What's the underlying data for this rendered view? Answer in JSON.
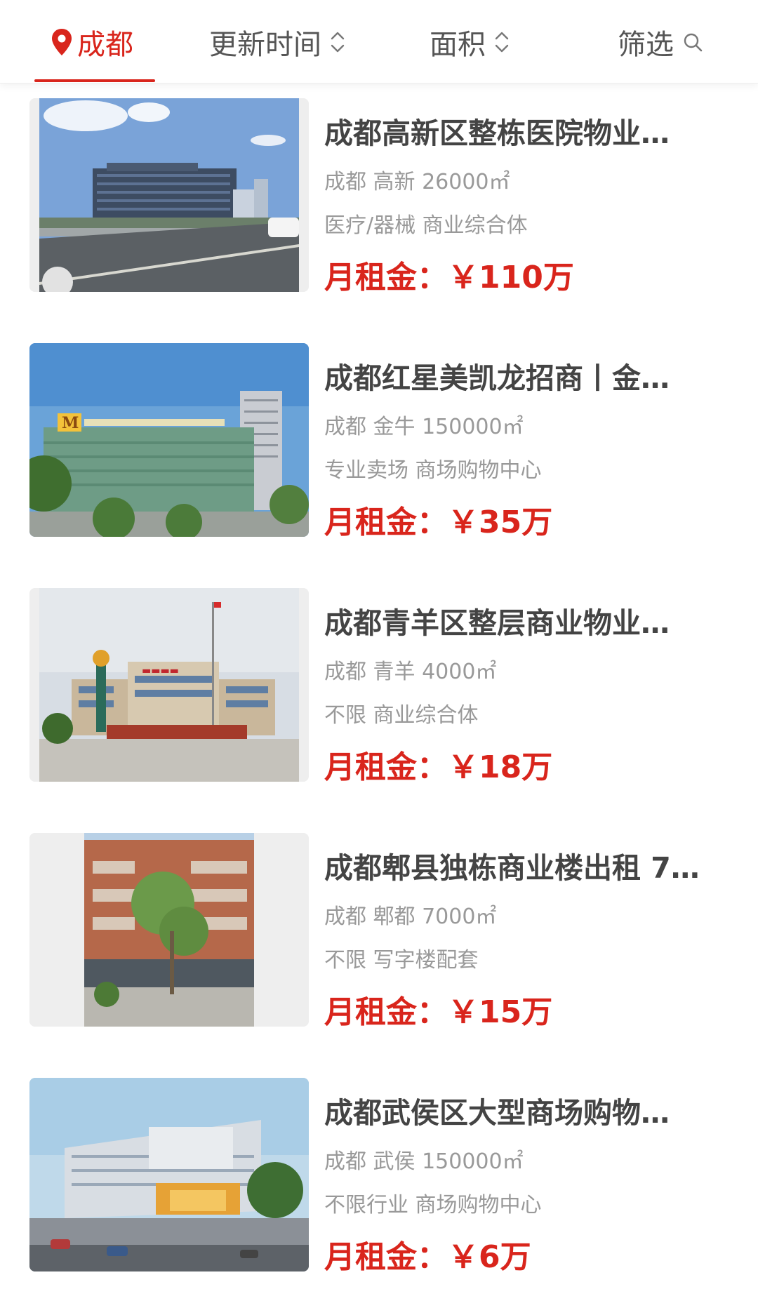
{
  "filter_bar": {
    "city": "成都",
    "sort_update": "更新时间",
    "sort_area": "面积",
    "filter": "筛选"
  },
  "colors": {
    "accent": "#d9251c",
    "title": "#444444",
    "meta": "#999999"
  },
  "listings": [
    {
      "title": "成都高新区整栋医院物业…",
      "location": "成都 高新 26000㎡",
      "category": "医疗/器械 商业综合体",
      "price_label": "月租金：",
      "price": "￥110万"
    },
    {
      "title": "成都红星美凯龙招商丨金…",
      "location": "成都 金牛 150000㎡",
      "category": "专业卖场 商场购物中心",
      "price_label": "月租金：",
      "price": "￥35万"
    },
    {
      "title": "成都青羊区整层商业物业…",
      "location": "成都 青羊 4000㎡",
      "category": "不限 商业综合体",
      "price_label": "月租金：",
      "price": "￥18万"
    },
    {
      "title": "成都郫县独栋商业楼出租 7…",
      "location": "成都 郫都 7000㎡",
      "category": "不限 写字楼配套",
      "price_label": "月租金：",
      "price": "￥15万"
    },
    {
      "title": "成都武侯区大型商场购物…",
      "location": "成都 武侯 150000㎡",
      "category": "不限行业 商场购物中心",
      "price_label": "月租金：",
      "price": "￥6万"
    }
  ]
}
